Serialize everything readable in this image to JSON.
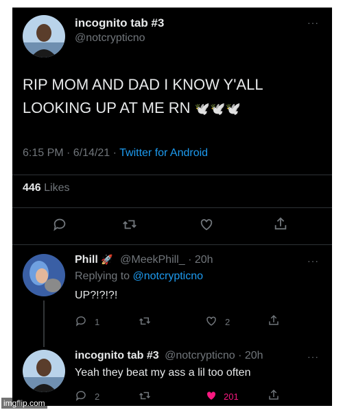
{
  "main_tweet": {
    "display_name": "incognito tab #3",
    "handle": "@notcrypticno",
    "text_line1": "RIP MOM AND DAD I KNOW Y'ALL",
    "text_line2": "LOOKING UP AT ME RN",
    "emoji": "🕊️🕊️🕊️",
    "time": "6:15 PM · 6/14/21 · ",
    "source": "Twitter for Android",
    "likes_count": "446",
    "likes_label": "Likes"
  },
  "reply1": {
    "display_name": "Phill",
    "name_emoji": "🚀",
    "handle_time": "@MeekPhill_ · 20h",
    "replying_prefix": "Replying to ",
    "replying_handle": "@notcrypticno",
    "text": "UP?!?!?!",
    "reply_count": "1",
    "like_count": "2"
  },
  "reply2": {
    "display_name": "incognito tab #3",
    "handle_time": "@notcrypticno · 20h",
    "text": "Yeah they beat my ass a lil too often",
    "reply_count": "2",
    "like_count": "201"
  },
  "more_glyph": "···",
  "watermark": "imgflip.com",
  "colors": {
    "background": "#000000",
    "text": "#e7e9ea",
    "secondary": "#71767b",
    "link": "#1d9bf0",
    "liked": "#f91880"
  }
}
